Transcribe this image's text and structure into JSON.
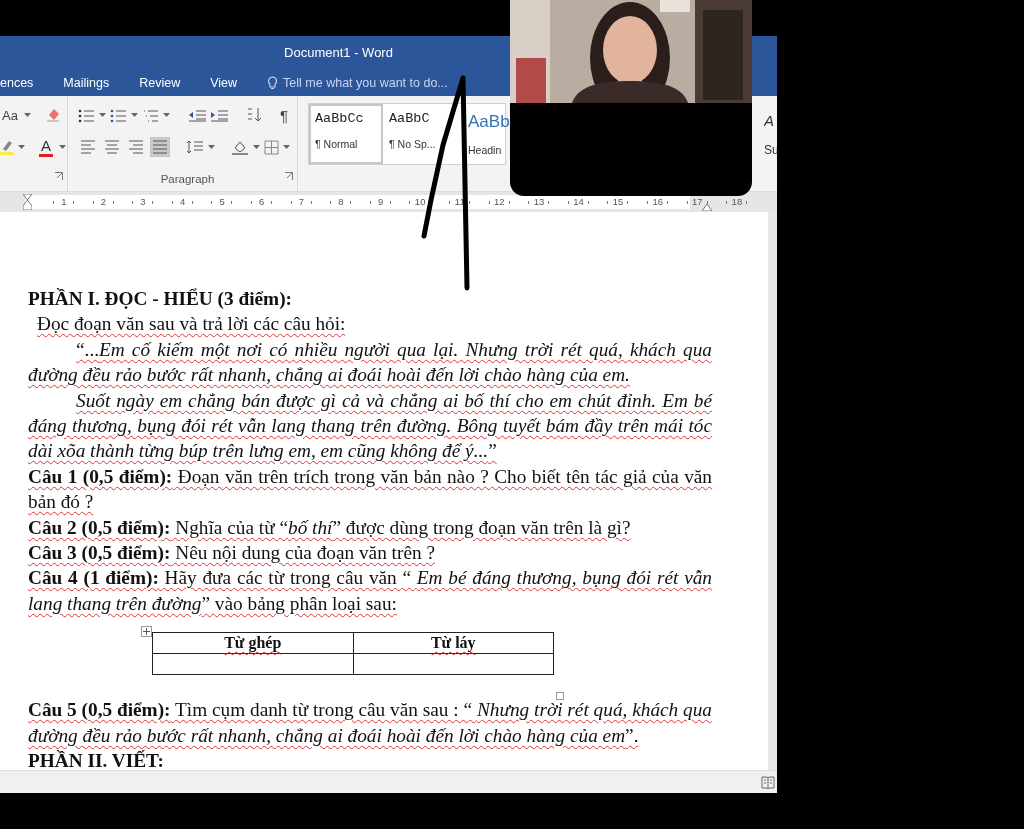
{
  "window": {
    "title": "Document1 - Word"
  },
  "tabs": [
    {
      "label": "ences"
    },
    {
      "label": "Mailings"
    },
    {
      "label": "Review"
    },
    {
      "label": "View"
    }
  ],
  "tell_me": {
    "placeholder": "Tell me what you want to do..."
  },
  "ribbon": {
    "font_size_button": "Aa",
    "font_color_button": "A",
    "show_marks_button": "¶",
    "paragraph_label": "Paragraph",
    "align_buttons": [
      {
        "kind": "left",
        "selected": false
      },
      {
        "kind": "center",
        "selected": false
      },
      {
        "kind": "right",
        "selected": false
      },
      {
        "kind": "justify",
        "selected": true
      }
    ],
    "styles": [
      {
        "sample": "AaBbCc",
        "name": "¶ Normal",
        "kind": "body",
        "selected": true
      },
      {
        "sample": "AaBbC",
        "name": "¶ No Sp...",
        "kind": "body",
        "selected": false
      },
      {
        "sample": "AaBb",
        "name": "Headin",
        "kind": "heading",
        "selected": false
      }
    ],
    "styles_cut": [
      {
        "sample": "A",
        "name": "Su"
      }
    ]
  },
  "ruler": {
    "numbers": [
      "1",
      "2",
      "3",
      "4",
      "5",
      "6",
      "7",
      "8",
      "9",
      "10",
      "11",
      "12",
      "13",
      "14",
      "15",
      "16",
      "17",
      "18"
    ]
  },
  "document": {
    "blocks": [
      {
        "kind": "heading",
        "text": "PHẦN I. ĐỌC - HIỂU (3 điểm):"
      },
      {
        "kind": "intro",
        "text": "Đọc đoạn văn sau và trả lời các câu hỏi:"
      },
      {
        "kind": "quote",
        "text": "“...*Em cố kiếm một nơi có nhiều người qua lại. Nhưng trời rét quá, khách qua đường đều rảo bước rất nhanh, chẳng ai đoái hoài đến lời chào hàng của em.*"
      },
      {
        "kind": "quote",
        "text": "*Suốt ngày em chẳng bán được gì cả và chẳng ai bố thí cho em chút đỉnh. Em bé đáng thương, bụng đói rét vẫn lang thang trên đường. Bông tuyết bám đầy trên mái tóc dài xõa thành từng búp trên lưng em, em cũng không để ý...*”"
      },
      {
        "kind": "question",
        "text": "**Câu 1 (0,5 điểm):** Đoạn văn trên trích trong văn bản nào ?  Cho biết tên tác giả của văn bản đó ?"
      },
      {
        "kind": "question",
        "text": "**Câu 2 (0,5 điểm):** Nghĩa của từ “*bố thí*” được dùng trong đoạn văn trên là gì?"
      },
      {
        "kind": "question",
        "text": "**Câu 3 (0,5 điểm):** Nêu nội dung của đoạn văn trên ?"
      },
      {
        "kind": "question",
        "text": "**Câu 4 (1 điểm):** Hãy đưa các từ trong câu văn “ *Em bé đáng thương, bụng đói rét vẫn lang thang trên đường*” vào bảng phân loại sau:"
      },
      {
        "kind": "table",
        "columns": [
          "Từ ghép",
          "Từ láy"
        ]
      },
      {
        "kind": "question",
        "text": "**Câu 5 (0,5 điểm):** Tìm cụm danh từ trong câu văn sau :  “ *Nhưng trời rét quá, khách qua đường đều rảo bước rất nhanh, chẳng ai đoái hoài đến lời chào hàng của em*”."
      },
      {
        "kind": "heading",
        "text": "PHẦN II. VIẾT:"
      }
    ]
  }
}
